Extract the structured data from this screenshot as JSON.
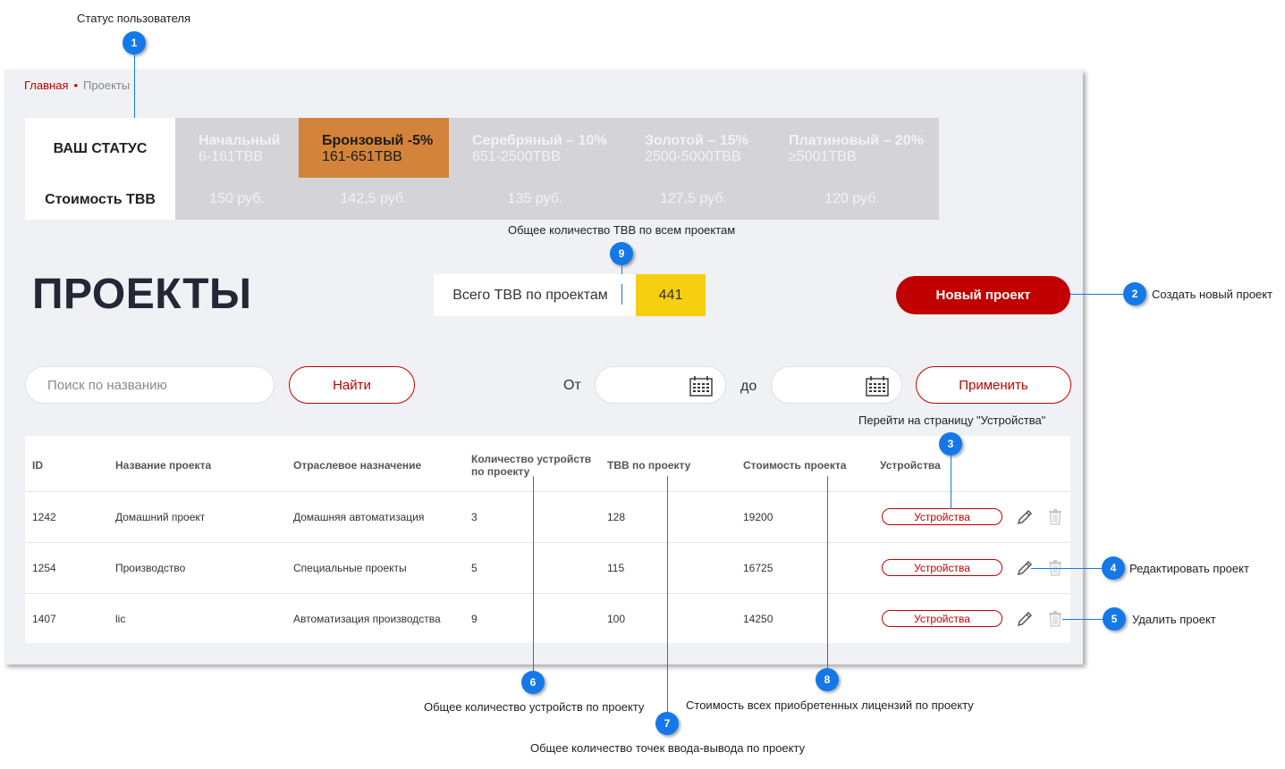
{
  "breadcrumb": {
    "home": "Главная",
    "current": "Проекты"
  },
  "status": {
    "label": "ВАШ СТАТУС",
    "price_label": "Стоимость ТВВ",
    "tiers": [
      {
        "name": "Начальный",
        "range": "6-161ТВВ",
        "price": "150 руб."
      },
      {
        "name": "Бронзовый -5%",
        "range": "161-651ТВВ",
        "price": "142,5 руб."
      },
      {
        "name": "Серебряный – 10%",
        "range": "651-2500ТВВ",
        "price": "135 руб."
      },
      {
        "name": "Золотой – 15%",
        "range": "2500-5000ТВВ",
        "price": "127,5 руб."
      },
      {
        "name": "Платиновый – 20%",
        "range": "≥5001ТВВ",
        "price": "120 руб."
      }
    ],
    "active_color": "#d4843a"
  },
  "page_title": "ПРОЕКТЫ",
  "total": {
    "label": "Всего ТВВ по проектам",
    "value": "441"
  },
  "new_project_label": "Новый проект",
  "filter": {
    "search_placeholder": "Поиск по названию",
    "find_label": "Найти",
    "from_label": "От",
    "to_label": "до",
    "apply_label": "Применить"
  },
  "table": {
    "headers": [
      "ID",
      "Название проекта",
      "Отраслевое назначение",
      "Количество устройств по проекту",
      "ТВВ по проекту",
      "Стоимость проекта",
      "Устройства"
    ],
    "rows": [
      {
        "id": "1242",
        "name": "Домашний проект",
        "sector": "Домашняя автоматизация",
        "devices": "3",
        "tvv": "128",
        "cost": "19200",
        "devices_btn": "Устройства"
      },
      {
        "id": "1254",
        "name": "Производство",
        "sector": "Специальные проекты",
        "devices": "5",
        "tvv": "115",
        "cost": "16725",
        "devices_btn": "Устройства"
      },
      {
        "id": "1407",
        "name": "lic",
        "sector": "Автоматизация производства",
        "devices": "9",
        "tvv": "100",
        "cost": "14250",
        "devices_btn": "Устройства"
      }
    ]
  },
  "callouts": {
    "c1": {
      "num": "1",
      "text": "Статус пользователя"
    },
    "c2": {
      "num": "2",
      "text": "Создать новый проект"
    },
    "c3": {
      "num": "3",
      "text": "Перейти на страницу \"Устройства\""
    },
    "c4": {
      "num": "4",
      "text": "Редактировать проект"
    },
    "c5": {
      "num": "5",
      "text": "Удалить проект"
    },
    "c6": {
      "num": "6",
      "text": "Общее количество устройств по проекту"
    },
    "c7": {
      "num": "7",
      "text": "Общее количество точек ввода-вывода по проекту"
    },
    "c8": {
      "num": "8",
      "text": "Стоимость всех приобретенных лицензий по проекту"
    },
    "c9": {
      "num": "9",
      "text": "Общее количество ТВВ по всем проектам"
    }
  },
  "colors": {
    "accent": "#c00000",
    "callout": "#1478e8",
    "highlight": "#f6cf10"
  }
}
